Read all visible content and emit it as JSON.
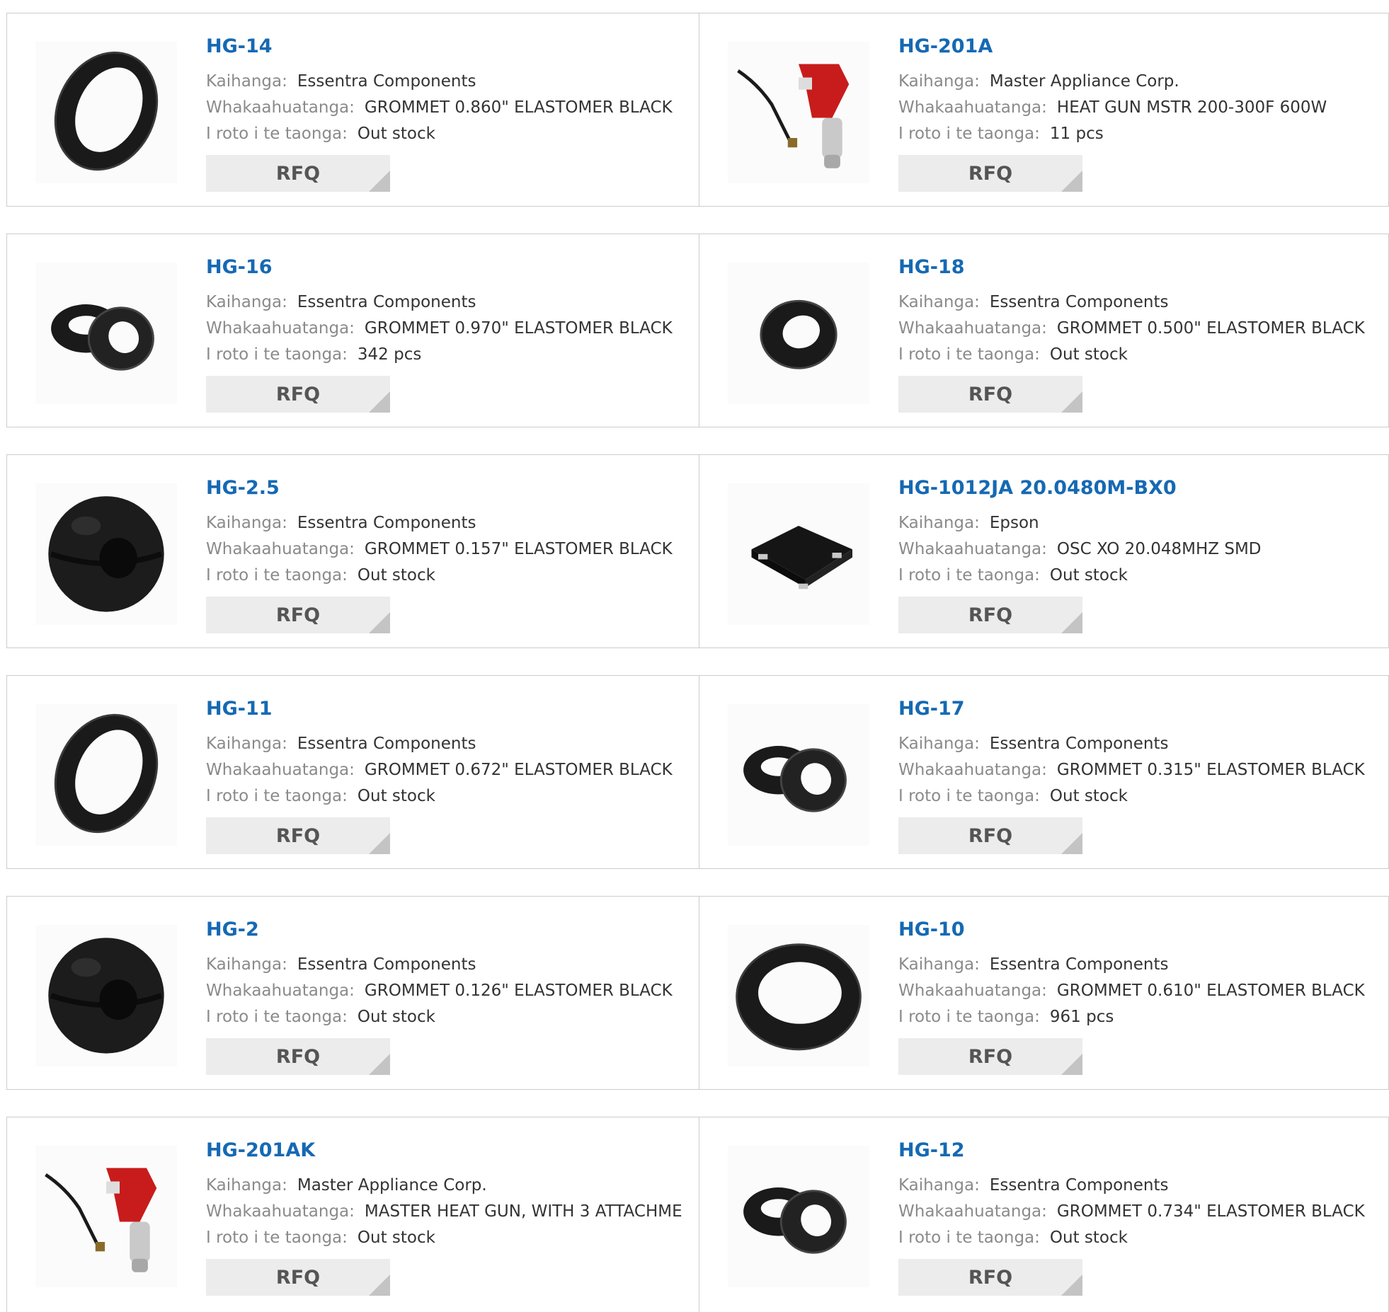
{
  "labels": {
    "manufacturer": "Kaihanga:",
    "description": "Whakaahuatanga:",
    "stock": "I roto i te taonga:",
    "rfq": "RFQ"
  },
  "colors": {
    "link": "#1669b3",
    "label": "#8a8a8a",
    "value": "#333333",
    "border": "#cccccc",
    "button_bg": "#ececec",
    "button_fold": "#c4c4c4"
  },
  "rows": [
    [
      {
        "part": "HG-14",
        "manufacturer": "Essentra Components",
        "description": "GROMMET 0.860\" ELASTOMER BLACK",
        "stock": "Out stock",
        "image_icon": "grommet-ring-icon"
      },
      {
        "part": "HG-201A",
        "manufacturer": "Master Appliance Corp.",
        "description": "HEAT GUN MSTR 200-300F 600W",
        "stock": "11 pcs",
        "image_icon": "heat-gun-icon"
      }
    ],
    [
      {
        "part": "HG-16",
        "manufacturer": "Essentra Components",
        "description": "GROMMET 0.970\" ELASTOMER BLACK",
        "stock": "342 pcs",
        "image_icon": "grommet-pair-icon"
      },
      {
        "part": "HG-18",
        "manufacturer": "Essentra Components",
        "description": "GROMMET 0.500\" ELASTOMER BLACK",
        "stock": "Out stock",
        "image_icon": "grommet-small-icon"
      }
    ],
    [
      {
        "part": "HG-2.5",
        "manufacturer": "Essentra Components",
        "description": "GROMMET 0.157\" ELASTOMER BLACK",
        "stock": "Out stock",
        "image_icon": "grommet-solid-icon"
      },
      {
        "part": "HG-1012JA 20.0480M-BX0",
        "manufacturer": "Epson",
        "description": "OSC XO 20.048MHZ SMD",
        "stock": "Out stock",
        "image_icon": "oscillator-chip-icon"
      }
    ],
    [
      {
        "part": "HG-11",
        "manufacturer": "Essentra Components",
        "description": "GROMMET 0.672\" ELASTOMER BLACK",
        "stock": "Out stock",
        "image_icon": "grommet-ring-icon"
      },
      {
        "part": "HG-17",
        "manufacturer": "Essentra Components",
        "description": "GROMMET 0.315\" ELASTOMER BLACK",
        "stock": "Out stock",
        "image_icon": "grommet-pair-icon"
      }
    ],
    [
      {
        "part": "HG-2",
        "manufacturer": "Essentra Components",
        "description": "GROMMET 0.126\" ELASTOMER BLACK",
        "stock": "Out stock",
        "image_icon": "grommet-solid-icon"
      },
      {
        "part": "HG-10",
        "manufacturer": "Essentra Components",
        "description": "GROMMET 0.610\" ELASTOMER BLACK",
        "stock": "961 pcs",
        "image_icon": "grommet-flat-icon"
      }
    ],
    [
      {
        "part": "HG-201AK",
        "manufacturer": "Master Appliance Corp.",
        "description": "MASTER HEAT GUN, WITH 3 ATTACHME",
        "stock": "Out stock",
        "image_icon": "heat-gun-icon"
      },
      {
        "part": "HG-12",
        "manufacturer": "Essentra Components",
        "description": "GROMMET 0.734\" ELASTOMER BLACK",
        "stock": "Out stock",
        "image_icon": "grommet-pair-icon"
      }
    ]
  ]
}
